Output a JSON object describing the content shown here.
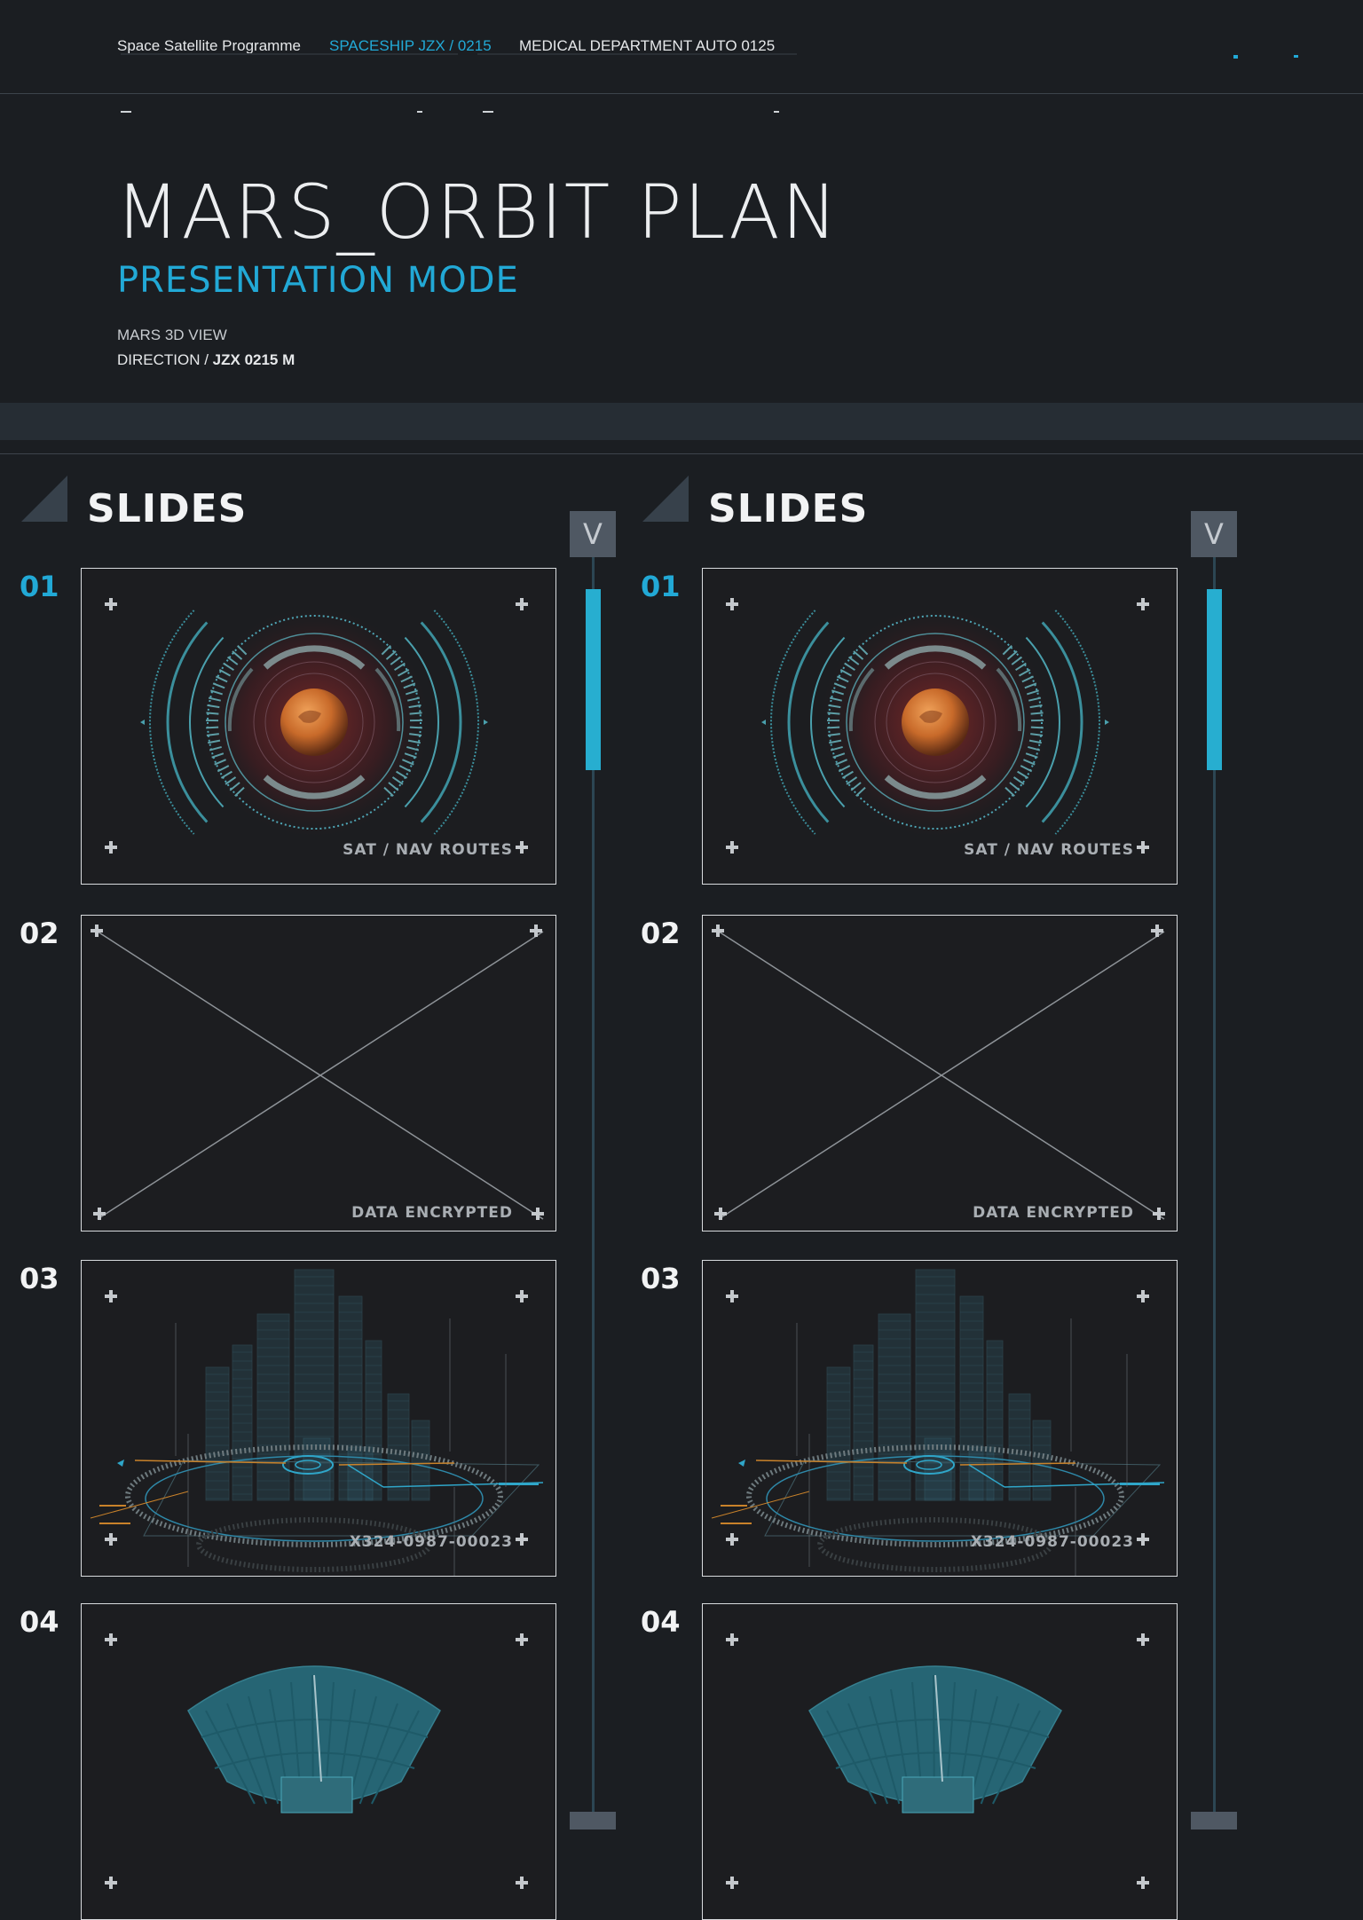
{
  "topnav": {
    "item1": "Space Satellite Programme",
    "item2": "SPACESHIP  JZX / 0215",
    "item3": "MEDICAL DEPARTMENT AUTO 0125"
  },
  "hero": {
    "title": "MARS_ORBIT PLAN",
    "subtitle": "PRESENTATION MODE",
    "meta_line1": "MARS 3D VIEW",
    "meta_line2_prefix": "DIRECTION / ",
    "meta_line2_bold": "JZX 0215  M"
  },
  "panels": [
    {
      "heading": "SLIDES",
      "scroll_up_label": "V",
      "slides": [
        {
          "number": "01",
          "caption": "SAT / NAV ROUTES",
          "content_type": "mars-hud"
        },
        {
          "number": "02",
          "caption": "DATA ENCRYPTED",
          "content_type": "placeholder-x"
        },
        {
          "number": "03",
          "caption": "X324-0987-00023",
          "content_type": "city-hologram"
        },
        {
          "number": "04",
          "caption": "",
          "content_type": "satellite-dish"
        }
      ]
    },
    {
      "heading": "SLIDES",
      "scroll_up_label": "V",
      "slides": [
        {
          "number": "01",
          "caption": "SAT / NAV ROUTES",
          "content_type": "mars-hud"
        },
        {
          "number": "02",
          "caption": "DATA ENCRYPTED",
          "content_type": "placeholder-x"
        },
        {
          "number": "03",
          "caption": "X324-0987-00023",
          "content_type": "city-hologram"
        },
        {
          "number": "04",
          "caption": "",
          "content_type": "satellite-dish"
        }
      ]
    }
  ],
  "colors": {
    "background": "#1b1e22",
    "accent": "#22a9d6",
    "band": "#262d34",
    "scroll_button": "#4f5863",
    "mars": "#c86a2a"
  }
}
